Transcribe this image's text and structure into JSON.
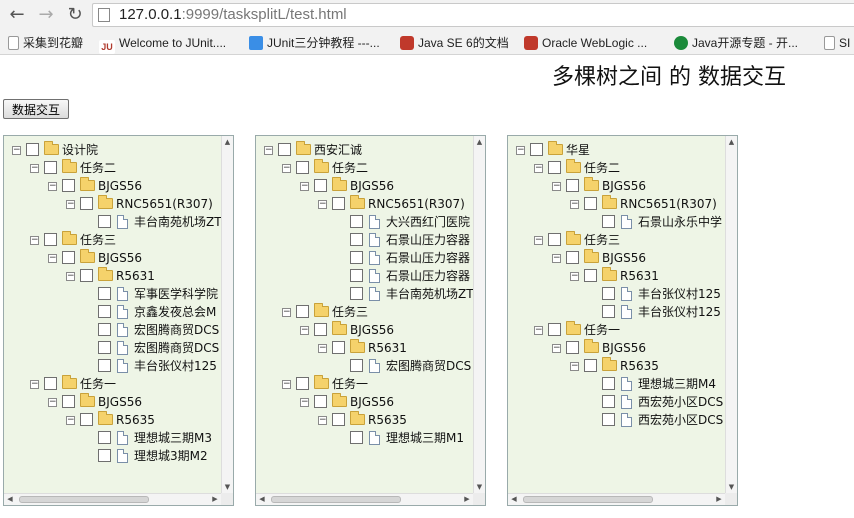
{
  "browser": {
    "url_host": "127.0.0.1",
    "url_path": ":9999/tasksplitL/test.html",
    "bookmarks": [
      {
        "label": "采集到花瓣",
        "icon": "page-icon"
      },
      {
        "label": "Welcome to JUnit....",
        "icon": "junit-icon"
      },
      {
        "label": "JUnit三分钟教程 ---...",
        "icon": "bookmark-icon"
      },
      {
        "label": "Java SE 6的文档",
        "icon": "oracle-icon"
      },
      {
        "label": "Oracle WebLogic ...",
        "icon": "oracle-icon"
      },
      {
        "label": "Java开源专题 - 开...",
        "icon": "c-icon"
      },
      {
        "label": "SI",
        "icon": "page-icon"
      }
    ]
  },
  "page": {
    "title": "多棵树之间 的 数据交互",
    "swap_button": "数据交互"
  },
  "trees": [
    {
      "root": "设计院",
      "nodes": [
        {
          "depth": 0,
          "type": "folder",
          "label": "设计院"
        },
        {
          "depth": 1,
          "type": "folder",
          "label": "任务二"
        },
        {
          "depth": 2,
          "type": "folder",
          "label": "BJGS56"
        },
        {
          "depth": 3,
          "type": "folder",
          "label": "RNC5651(R307)"
        },
        {
          "depth": 4,
          "type": "doc",
          "label": "丰台南苑机场ZT"
        },
        {
          "depth": 1,
          "type": "folder",
          "label": "任务三"
        },
        {
          "depth": 2,
          "type": "folder",
          "label": "BJGS56"
        },
        {
          "depth": 3,
          "type": "folder",
          "label": "R5631"
        },
        {
          "depth": 4,
          "type": "doc",
          "label": "军事医学科学院"
        },
        {
          "depth": 4,
          "type": "doc",
          "label": "京鑫发夜总会M"
        },
        {
          "depth": 4,
          "type": "doc",
          "label": "宏图腾商贸DCS"
        },
        {
          "depth": 4,
          "type": "doc",
          "label": "宏图腾商贸DCS"
        },
        {
          "depth": 4,
          "type": "doc",
          "label": "丰台张仪村125"
        },
        {
          "depth": 1,
          "type": "folder",
          "label": "任务一"
        },
        {
          "depth": 2,
          "type": "folder",
          "label": "BJGS56"
        },
        {
          "depth": 3,
          "type": "folder",
          "label": "R5635"
        },
        {
          "depth": 4,
          "type": "doc",
          "label": "理想城三期M3"
        },
        {
          "depth": 4,
          "type": "doc",
          "label": "理想城3期M2"
        }
      ]
    },
    {
      "root": "西安汇诚",
      "nodes": [
        {
          "depth": 0,
          "type": "folder",
          "label": "西安汇诚"
        },
        {
          "depth": 1,
          "type": "folder",
          "label": "任务二"
        },
        {
          "depth": 2,
          "type": "folder",
          "label": "BJGS56"
        },
        {
          "depth": 3,
          "type": "folder",
          "label": "RNC5651(R307)"
        },
        {
          "depth": 4,
          "type": "doc",
          "label": "大兴西红门医院"
        },
        {
          "depth": 4,
          "type": "doc",
          "label": "石景山压力容器"
        },
        {
          "depth": 4,
          "type": "doc",
          "label": "石景山压力容器"
        },
        {
          "depth": 4,
          "type": "doc",
          "label": "石景山压力容器"
        },
        {
          "depth": 4,
          "type": "doc",
          "label": "丰台南苑机场ZT"
        },
        {
          "depth": 1,
          "type": "folder",
          "label": "任务三"
        },
        {
          "depth": 2,
          "type": "folder",
          "label": "BJGS56"
        },
        {
          "depth": 3,
          "type": "folder",
          "label": "R5631"
        },
        {
          "depth": 4,
          "type": "doc",
          "label": "宏图腾商贸DCS"
        },
        {
          "depth": 1,
          "type": "folder",
          "label": "任务一"
        },
        {
          "depth": 2,
          "type": "folder",
          "label": "BJGS56"
        },
        {
          "depth": 3,
          "type": "folder",
          "label": "R5635"
        },
        {
          "depth": 4,
          "type": "doc",
          "label": "理想城三期M1"
        }
      ]
    },
    {
      "root": "华星",
      "nodes": [
        {
          "depth": 0,
          "type": "folder",
          "label": "华星"
        },
        {
          "depth": 1,
          "type": "folder",
          "label": "任务二"
        },
        {
          "depth": 2,
          "type": "folder",
          "label": "BJGS56"
        },
        {
          "depth": 3,
          "type": "folder",
          "label": "RNC5651(R307)"
        },
        {
          "depth": 4,
          "type": "doc",
          "label": "石景山永乐中学"
        },
        {
          "depth": 1,
          "type": "folder",
          "label": "任务三"
        },
        {
          "depth": 2,
          "type": "folder",
          "label": "BJGS56"
        },
        {
          "depth": 3,
          "type": "folder",
          "label": "R5631"
        },
        {
          "depth": 4,
          "type": "doc",
          "label": "丰台张仪村125"
        },
        {
          "depth": 4,
          "type": "doc",
          "label": "丰台张仪村125"
        },
        {
          "depth": 1,
          "type": "folder",
          "label": "任务一"
        },
        {
          "depth": 2,
          "type": "folder",
          "label": "BJGS56"
        },
        {
          "depth": 3,
          "type": "folder",
          "label": "R5635"
        },
        {
          "depth": 4,
          "type": "doc",
          "label": "理想城三期M4"
        },
        {
          "depth": 4,
          "type": "doc",
          "label": "西宏苑小区DCS"
        },
        {
          "depth": 4,
          "type": "doc",
          "label": "西宏苑小区DCS"
        }
      ]
    }
  ]
}
